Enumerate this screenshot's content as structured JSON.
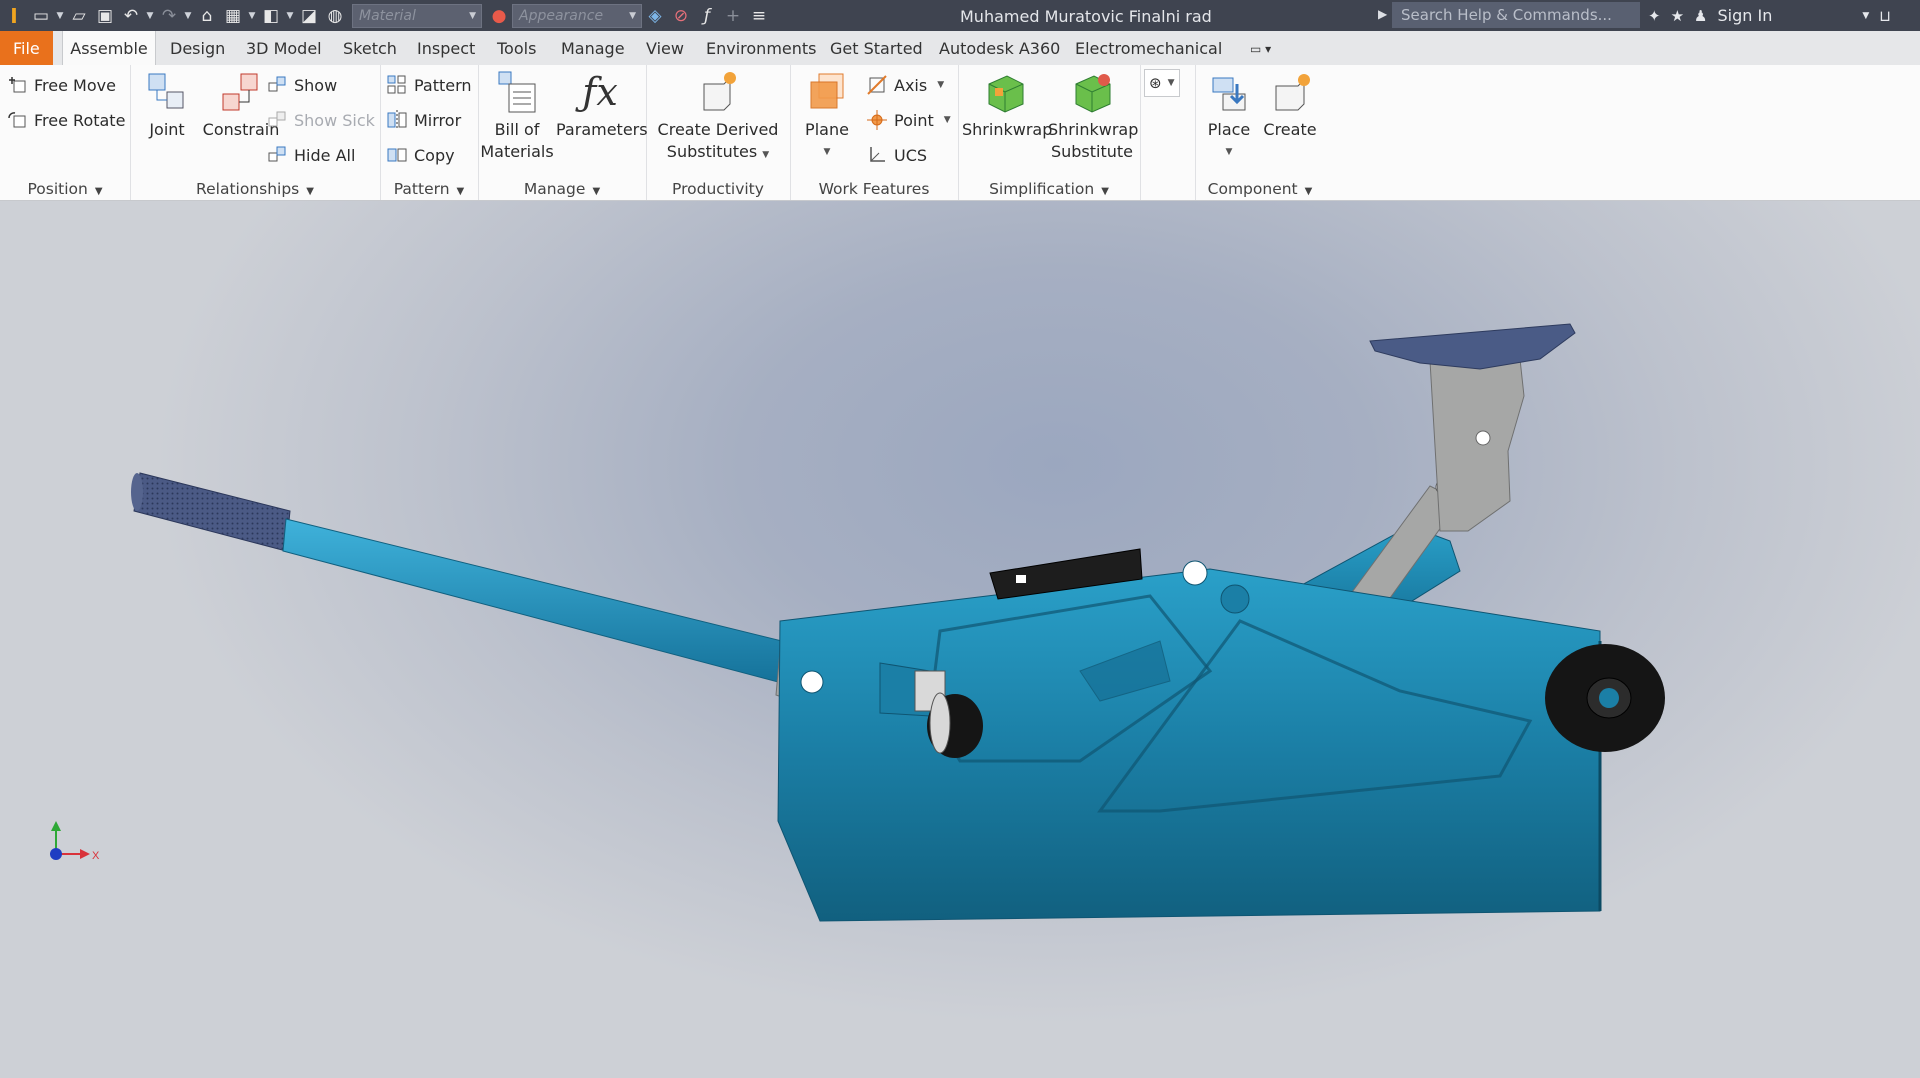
{
  "titlebar": {
    "app_logo": "I",
    "material_placeholder": "Material",
    "appearance_placeholder": "Appearance",
    "document_title": "Muhamed Muratovic Finalni rad",
    "search_placeholder": "Search Help & Commands...",
    "sign_in": "Sign In",
    "icons": [
      "new-icon",
      "open-icon",
      "save-icon",
      "undo-icon",
      "redo-icon",
      "home-icon",
      "projects-icon",
      "select-icon",
      "color-icon",
      "globe-icon",
      "appearance-icon",
      "clear-appearance-icon",
      "fx-icon",
      "plus-icon",
      "customize-icon",
      "exchange-icon",
      "star-icon",
      "user-icon",
      "cart-icon"
    ]
  },
  "tabs": [
    {
      "label": "File"
    },
    {
      "label": "Assemble"
    },
    {
      "label": "Design"
    },
    {
      "label": "3D Model"
    },
    {
      "label": "Sketch"
    },
    {
      "label": "Inspect"
    },
    {
      "label": "Tools"
    },
    {
      "label": "Manage"
    },
    {
      "label": "View"
    },
    {
      "label": "Environments"
    },
    {
      "label": "Get Started"
    },
    {
      "label": "Autodesk A360"
    },
    {
      "label": "Electromechanical"
    }
  ],
  "ribbon": {
    "position": {
      "free_move": "Free Move",
      "free_rotate": "Free Rotate",
      "label": "Position"
    },
    "relationships": {
      "joint": "Joint",
      "constrain": "Constrain",
      "show": "Show",
      "show_sick": "Show Sick",
      "hide_all": "Hide All",
      "label": "Relationships"
    },
    "pattern": {
      "pattern": "Pattern",
      "mirror": "Mirror",
      "copy": "Copy",
      "label": "Pattern"
    },
    "manage": {
      "bom_line1": "Bill of",
      "bom_line2": "Materials",
      "parameters": "Parameters",
      "label": "Manage"
    },
    "productivity": {
      "line1": "Create Derived",
      "line2": "Substitutes",
      "label": "Productivity"
    },
    "work_features": {
      "plane": "Plane",
      "axis": "Axis",
      "point": "Point",
      "ucs": "UCS",
      "label": "Work Features"
    },
    "simplification": {
      "shrinkwrap": "Shrinkwrap",
      "sws_line1": "Shrinkwrap",
      "sws_line2": "Substitute",
      "label": "Simplification"
    },
    "component": {
      "place": "Place",
      "create": "Create",
      "label": "Component"
    }
  },
  "viewport": {
    "triad": {
      "x_label": "X"
    },
    "colors": {
      "body": "#1b7fa6",
      "body_dark": "#14607f",
      "gray": "#a6a7a6",
      "saddle": "#4a5b86",
      "wheel": "#111111"
    }
  }
}
